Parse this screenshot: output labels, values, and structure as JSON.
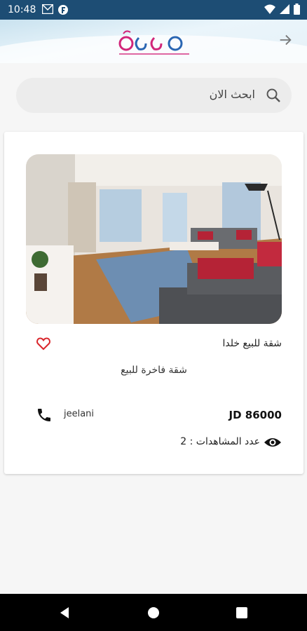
{
  "status_bar": {
    "time": "10:48"
  },
  "search": {
    "placeholder": "ابحث الان"
  },
  "listing": {
    "title": "شقة للبيع خلدا",
    "subtitle": "شقة فاخرة للبيع",
    "owner": "jeelani",
    "price": "JD 86000",
    "views_text": "عدد المشاهدات : 2"
  },
  "colors": {
    "status_bar": "#1d4d74",
    "favorite_heart": "#d9252b",
    "logo_blue": "#2a66b3",
    "logo_magenta": "#d1267a"
  },
  "icons": [
    "back-arrow-icon",
    "search-icon",
    "heart-outline-icon",
    "phone-icon",
    "eye-icon",
    "nav-back-icon",
    "nav-home-icon",
    "nav-recents-icon"
  ]
}
